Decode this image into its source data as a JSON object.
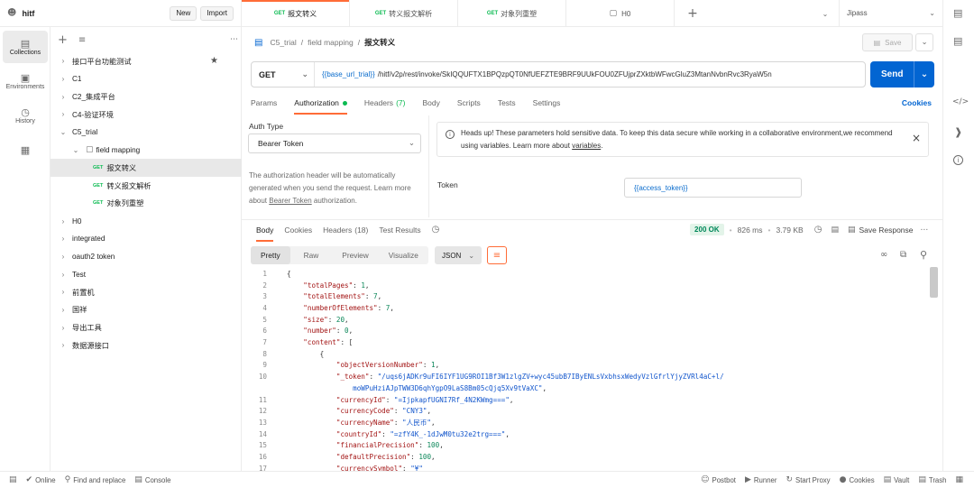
{
  "workspace": {
    "name": "hitf",
    "new_label": "New",
    "import_label": "Import"
  },
  "rail": [
    {
      "label": "Collections",
      "icon": "collections-icon"
    },
    {
      "label": "Environments",
      "icon": "environments-icon"
    },
    {
      "label": "History",
      "icon": "history-icon"
    },
    {
      "label": "",
      "icon": "apps-icon"
    }
  ],
  "tabs": [
    {
      "method": "GET",
      "label": "报文转义"
    },
    {
      "method": "GET",
      "label": "转义报文解析"
    },
    {
      "method": "GET",
      "label": "对象列重塑"
    },
    {
      "method": "",
      "label": "H0"
    }
  ],
  "env_selector": {
    "value": "Jipass"
  },
  "sidebar": {
    "items": [
      {
        "label": "接口平台功能测试",
        "level": 0,
        "type": "collection",
        "star": true
      },
      {
        "label": "C1",
        "level": 0,
        "type": "collection"
      },
      {
        "label": "C2_集成平台",
        "level": 0,
        "type": "collection"
      },
      {
        "label": "C4-验证环境",
        "level": 0,
        "type": "collection"
      },
      {
        "label": "C5_trial",
        "level": 0,
        "type": "collection",
        "open": true
      },
      {
        "label": "field mapping",
        "level": 1,
        "type": "folder",
        "open": true
      },
      {
        "label": "报文转义",
        "level": 2,
        "type": "request",
        "method": "GET",
        "selected": true
      },
      {
        "label": "转义报文解析",
        "level": 2,
        "type": "request",
        "method": "GET"
      },
      {
        "label": "对象列重塑",
        "level": 2,
        "type": "request",
        "method": "GET"
      },
      {
        "label": "H0",
        "level": 0,
        "type": "collection"
      },
      {
        "label": "integrated",
        "level": 0,
        "type": "collection"
      },
      {
        "label": "oauth2 token",
        "level": 0,
        "type": "collection"
      },
      {
        "label": "Test",
        "level": 0,
        "type": "collection"
      },
      {
        "label": "前置机",
        "level": 0,
        "type": "collection"
      },
      {
        "label": "国祥",
        "level": 0,
        "type": "collection"
      },
      {
        "label": "导出工具",
        "level": 0,
        "type": "collection"
      },
      {
        "label": "数据源接口",
        "level": 0,
        "type": "collection"
      }
    ]
  },
  "breadcrumb": {
    "c1": "C5_trial",
    "c2": "field mapping",
    "current": "报文转义",
    "save": "Save"
  },
  "request": {
    "method": "GET",
    "url_var": "{{base_url_trial}}",
    "url_rest": "/hitf/v2p/rest/invoke/SkIQQUFTX1BPQzpQT0NfUEFZTE9BRF9UUkFOU0ZFUjprZXktbWFwcGluZ3MtanNvbnRvc3RyaW5n",
    "send": "Send"
  },
  "request_tabs": [
    {
      "label": "Params"
    },
    {
      "label": "Authorization",
      "dot": true
    },
    {
      "label": "Headers",
      "count": "(7)"
    },
    {
      "label": "Body"
    },
    {
      "label": "Scripts"
    },
    {
      "label": "Tests"
    },
    {
      "label": "Settings"
    }
  ],
  "cookies_link": "Cookies",
  "auth": {
    "type_label": "Auth Type",
    "type_value": "Bearer Token",
    "desc_1": "The authorization header will be automatically generated when you send the request. Learn more about ",
    "desc_link": "Bearer Token",
    "desc_2": " authorization.",
    "notice_1": "Heads up! These parameters hold sensitive data. To keep this data secure while working in a collaborative environment,we recommend using variables. Learn more about ",
    "notice_link": "variables",
    "notice_2": ".",
    "token_label": "Token",
    "token_value": "{{access_token}}"
  },
  "response": {
    "tabs": [
      {
        "label": "Body"
      },
      {
        "label": "Cookies"
      },
      {
        "label": "Headers",
        "count": "(18)"
      },
      {
        "label": "Test Results"
      }
    ],
    "status": "200 OK",
    "time": "826 ms",
    "size": "3.79 KB",
    "save": "Save Response",
    "formats": [
      "Pretty",
      "Raw",
      "Preview",
      "Visualize"
    ],
    "lang": "JSON"
  },
  "code_lines": [
    {
      "n": "1",
      "t": [
        [
          "p",
          "{"
        ]
      ]
    },
    {
      "n": "2",
      "t": [
        [
          "p",
          "    "
        ],
        [
          "k",
          "\"totalPages\""
        ],
        [
          "p",
          ": "
        ],
        [
          "n",
          "1"
        ],
        [
          "p",
          ","
        ]
      ]
    },
    {
      "n": "3",
      "t": [
        [
          "p",
          "    "
        ],
        [
          "k",
          "\"totalElements\""
        ],
        [
          "p",
          ": "
        ],
        [
          "n",
          "7"
        ],
        [
          "p",
          ","
        ]
      ]
    },
    {
      "n": "4",
      "t": [
        [
          "p",
          "    "
        ],
        [
          "k",
          "\"numberOfElements\""
        ],
        [
          "p",
          ": "
        ],
        [
          "n",
          "7"
        ],
        [
          "p",
          ","
        ]
      ]
    },
    {
      "n": "5",
      "t": [
        [
          "p",
          "    "
        ],
        [
          "k",
          "\"size\""
        ],
        [
          "p",
          ": "
        ],
        [
          "n",
          "20"
        ],
        [
          "p",
          ","
        ]
      ]
    },
    {
      "n": "6",
      "t": [
        [
          "p",
          "    "
        ],
        [
          "k",
          "\"number\""
        ],
        [
          "p",
          ": "
        ],
        [
          "n",
          "0"
        ],
        [
          "p",
          ","
        ]
      ]
    },
    {
      "n": "7",
      "t": [
        [
          "p",
          "    "
        ],
        [
          "k",
          "\"content\""
        ],
        [
          "p",
          ": ["
        ]
      ]
    },
    {
      "n": "8",
      "t": [
        [
          "p",
          "        {"
        ]
      ]
    },
    {
      "n": "9",
      "t": [
        [
          "p",
          "            "
        ],
        [
          "k",
          "\"objectVersionNumber\""
        ],
        [
          "p",
          ": "
        ],
        [
          "n",
          "1"
        ],
        [
          "p",
          ","
        ]
      ]
    },
    {
      "n": "10",
      "t": [
        [
          "p",
          "            "
        ],
        [
          "k",
          "\"_token\""
        ],
        [
          "p",
          ": "
        ],
        [
          "s",
          "\"/uqs6jADKr9uFI6IYF1UG9ROI1Bf3W1zlgZV+wyc45ubB7IByENLsVxbhsxWedyVzlGfrlYjyZVRl4aC+l/"
        ]
      ]
    },
    {
      "n": "",
      "t": [
        [
          "p",
          "                "
        ],
        [
          "s",
          "moWPuHziAJpTWW3D6qhYgpO9LaS8Bm05cQjq5Xv9tVaXC\""
        ],
        [
          "p",
          ","
        ]
      ]
    },
    {
      "n": "11",
      "t": [
        [
          "p",
          "            "
        ],
        [
          "k",
          "\"currencyId\""
        ],
        [
          "p",
          ": "
        ],
        [
          "s",
          "\"=IjpkapfUGNI7Rf_4N2KWmg===\""
        ],
        [
          "p",
          ","
        ]
      ]
    },
    {
      "n": "12",
      "t": [
        [
          "p",
          "            "
        ],
        [
          "k",
          "\"currencyCode\""
        ],
        [
          "p",
          ": "
        ],
        [
          "s",
          "\"CNY3\""
        ],
        [
          "p",
          ","
        ]
      ]
    },
    {
      "n": "13",
      "t": [
        [
          "p",
          "            "
        ],
        [
          "k",
          "\"currencyName\""
        ],
        [
          "p",
          ": "
        ],
        [
          "s",
          "\"人民币\""
        ],
        [
          "p",
          ","
        ]
      ]
    },
    {
      "n": "14",
      "t": [
        [
          "p",
          "            "
        ],
        [
          "k",
          "\"countryId\""
        ],
        [
          "p",
          ": "
        ],
        [
          "s",
          "\"=zfY4K_-1dJwM0tu32e2trg===\""
        ],
        [
          "p",
          ","
        ]
      ]
    },
    {
      "n": "15",
      "t": [
        [
          "p",
          "            "
        ],
        [
          "k",
          "\"financialPrecision\""
        ],
        [
          "p",
          ": "
        ],
        [
          "n",
          "100"
        ],
        [
          "p",
          ","
        ]
      ]
    },
    {
      "n": "16",
      "t": [
        [
          "p",
          "            "
        ],
        [
          "k",
          "\"defaultPrecision\""
        ],
        [
          "p",
          ": "
        ],
        [
          "n",
          "100"
        ],
        [
          "p",
          ","
        ]
      ]
    },
    {
      "n": "17",
      "t": [
        [
          "p",
          "            "
        ],
        [
          "k",
          "\"currencySymbol\""
        ],
        [
          "p",
          ": "
        ],
        [
          "s",
          "\"¥\""
        ]
      ]
    }
  ],
  "status_bar": {
    "online": "Online",
    "find": "Find and replace",
    "console": "Console",
    "postbot": "Postbot",
    "runner": "Runner",
    "proxy": "Start Proxy",
    "cookies": "Cookies",
    "vault": "Vault",
    "trash": "Trash"
  },
  "colors": {
    "accent": "#ff6c37",
    "send": "#0265d2",
    "get": "#0cbb52",
    "status_ok": "#00875a"
  }
}
